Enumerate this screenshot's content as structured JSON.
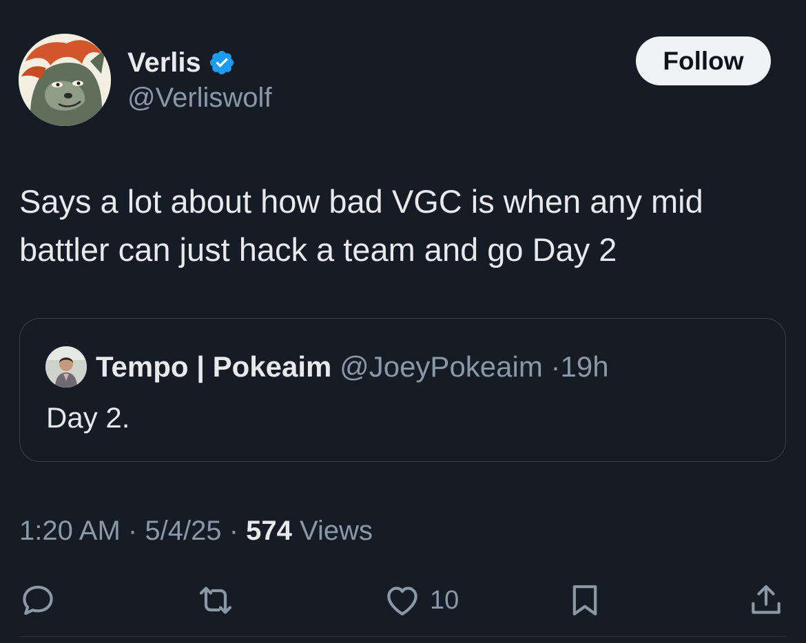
{
  "author": {
    "display_name": "Verlis",
    "handle": "@Verliswolf",
    "verified_icon": "verified-badge-icon",
    "avatar_icon": "wolf-avatar"
  },
  "follow_button": {
    "label": "Follow"
  },
  "tweet": {
    "text": "Says a lot about how bad VGC is when any mid battler can just hack a team and go Day 2"
  },
  "quoted_tweet": {
    "display_name": "Tempo | Pokeaim",
    "handle": "@JoeyPokeaim",
    "separator": "·",
    "age": "19h",
    "text": "Day 2."
  },
  "meta": {
    "time": "1:20 AM",
    "separator": "·",
    "date": "5/4/25",
    "views_count": "574",
    "views_label": "Views"
  },
  "actions": {
    "reply_icon": "reply-icon",
    "retweet_icon": "retweet-icon",
    "like_icon": "heart-icon",
    "like_count": "10",
    "bookmark_icon": "bookmark-icon",
    "share_icon": "share-icon"
  },
  "colors": {
    "background": "#161c26",
    "primary_text": "#e7e9ea",
    "secondary_text": "#8b98a5",
    "verified_blue": "#1d9bf0",
    "follow_button_bg": "#eff3f4",
    "card_border": "#38434f"
  }
}
